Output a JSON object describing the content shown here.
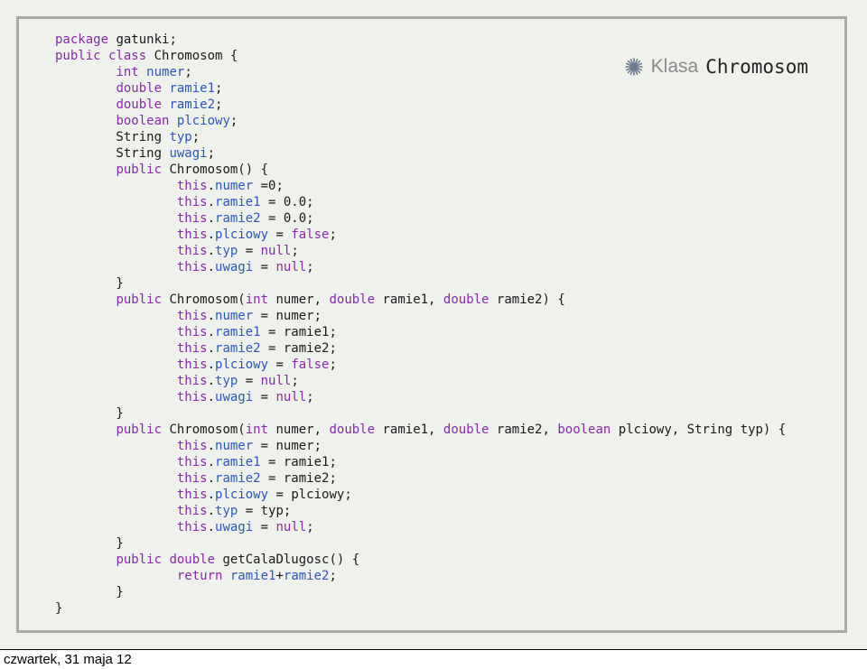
{
  "title": {
    "prefix": "Klasa",
    "class_name": "Chromosom",
    "bullet_icon": "asterisk-bullet-icon"
  },
  "footer": {
    "date": "czwartek, 31 maja 12"
  },
  "colors": {
    "keyword": "#862ba8",
    "identifier": "#2f55b8",
    "plain": "#1a1a1a",
    "background": "#eef1ec"
  },
  "code_lines": [
    [
      {
        "t": "kw",
        "v": "package"
      },
      {
        "t": "plain",
        "v": " gatunki;"
      }
    ],
    [
      {
        "t": "kw",
        "v": "public class"
      },
      {
        "t": "plain",
        "v": " Chromosom {"
      }
    ],
    [
      {
        "t": "plain",
        "v": "        "
      },
      {
        "t": "kw",
        "v": "int"
      },
      {
        "t": "plain",
        "v": " "
      },
      {
        "t": "id",
        "v": "numer"
      },
      {
        "t": "plain",
        "v": ";"
      }
    ],
    [
      {
        "t": "plain",
        "v": "        "
      },
      {
        "t": "kw",
        "v": "double"
      },
      {
        "t": "plain",
        "v": " "
      },
      {
        "t": "id",
        "v": "ramie1"
      },
      {
        "t": "plain",
        "v": ";"
      }
    ],
    [
      {
        "t": "plain",
        "v": "        "
      },
      {
        "t": "kw",
        "v": "double"
      },
      {
        "t": "plain",
        "v": " "
      },
      {
        "t": "id",
        "v": "ramie2"
      },
      {
        "t": "plain",
        "v": ";"
      }
    ],
    [
      {
        "t": "plain",
        "v": "        "
      },
      {
        "t": "kw",
        "v": "boolean"
      },
      {
        "t": "plain",
        "v": " "
      },
      {
        "t": "id",
        "v": "plciowy"
      },
      {
        "t": "plain",
        "v": ";"
      }
    ],
    [
      {
        "t": "plain",
        "v": "        String "
      },
      {
        "t": "id",
        "v": "typ"
      },
      {
        "t": "plain",
        "v": ";"
      }
    ],
    [
      {
        "t": "plain",
        "v": "        String "
      },
      {
        "t": "id",
        "v": "uwagi"
      },
      {
        "t": "plain",
        "v": ";"
      }
    ],
    [
      {
        "t": "plain",
        "v": "        "
      },
      {
        "t": "kw",
        "v": "public"
      },
      {
        "t": "plain",
        "v": " Chromosom() {"
      }
    ],
    [
      {
        "t": "plain",
        "v": "                "
      },
      {
        "t": "kw",
        "v": "this"
      },
      {
        "t": "plain",
        "v": "."
      },
      {
        "t": "id",
        "v": "numer"
      },
      {
        "t": "plain",
        "v": " =0;"
      }
    ],
    [
      {
        "t": "plain",
        "v": "                "
      },
      {
        "t": "kw",
        "v": "this"
      },
      {
        "t": "plain",
        "v": "."
      },
      {
        "t": "id",
        "v": "ramie1"
      },
      {
        "t": "plain",
        "v": " = 0.0;"
      }
    ],
    [
      {
        "t": "plain",
        "v": "                "
      },
      {
        "t": "kw",
        "v": "this"
      },
      {
        "t": "plain",
        "v": "."
      },
      {
        "t": "id",
        "v": "ramie2"
      },
      {
        "t": "plain",
        "v": " = 0.0;"
      }
    ],
    [
      {
        "t": "plain",
        "v": "                "
      },
      {
        "t": "kw",
        "v": "this"
      },
      {
        "t": "plain",
        "v": "."
      },
      {
        "t": "id",
        "v": "plciowy"
      },
      {
        "t": "plain",
        "v": " = "
      },
      {
        "t": "kw",
        "v": "false"
      },
      {
        "t": "plain",
        "v": ";"
      }
    ],
    [
      {
        "t": "plain",
        "v": "                "
      },
      {
        "t": "kw",
        "v": "this"
      },
      {
        "t": "plain",
        "v": "."
      },
      {
        "t": "id",
        "v": "typ"
      },
      {
        "t": "plain",
        "v": " = "
      },
      {
        "t": "kw",
        "v": "null"
      },
      {
        "t": "plain",
        "v": ";"
      }
    ],
    [
      {
        "t": "plain",
        "v": "                "
      },
      {
        "t": "kw",
        "v": "this"
      },
      {
        "t": "plain",
        "v": "."
      },
      {
        "t": "id",
        "v": "uwagi"
      },
      {
        "t": "plain",
        "v": " = "
      },
      {
        "t": "kw",
        "v": "null"
      },
      {
        "t": "plain",
        "v": ";"
      }
    ],
    [
      {
        "t": "plain",
        "v": "        }"
      }
    ],
    [
      {
        "t": "plain",
        "v": "        "
      },
      {
        "t": "kw",
        "v": "public"
      },
      {
        "t": "plain",
        "v": " Chromosom("
      },
      {
        "t": "kw",
        "v": "int"
      },
      {
        "t": "plain",
        "v": " numer, "
      },
      {
        "t": "kw",
        "v": "double"
      },
      {
        "t": "plain",
        "v": " ramie1, "
      },
      {
        "t": "kw",
        "v": "double"
      },
      {
        "t": "plain",
        "v": " ramie2) {"
      }
    ],
    [
      {
        "t": "plain",
        "v": "                "
      },
      {
        "t": "kw",
        "v": "this"
      },
      {
        "t": "plain",
        "v": "."
      },
      {
        "t": "id",
        "v": "numer"
      },
      {
        "t": "plain",
        "v": " = numer;"
      }
    ],
    [
      {
        "t": "plain",
        "v": "                "
      },
      {
        "t": "kw",
        "v": "this"
      },
      {
        "t": "plain",
        "v": "."
      },
      {
        "t": "id",
        "v": "ramie1"
      },
      {
        "t": "plain",
        "v": " = ramie1;"
      }
    ],
    [
      {
        "t": "plain",
        "v": "                "
      },
      {
        "t": "kw",
        "v": "this"
      },
      {
        "t": "plain",
        "v": "."
      },
      {
        "t": "id",
        "v": "ramie2"
      },
      {
        "t": "plain",
        "v": " = ramie2;"
      }
    ],
    [
      {
        "t": "plain",
        "v": "                "
      },
      {
        "t": "kw",
        "v": "this"
      },
      {
        "t": "plain",
        "v": "."
      },
      {
        "t": "id",
        "v": "plciowy"
      },
      {
        "t": "plain",
        "v": " = "
      },
      {
        "t": "kw",
        "v": "false"
      },
      {
        "t": "plain",
        "v": ";"
      }
    ],
    [
      {
        "t": "plain",
        "v": "                "
      },
      {
        "t": "kw",
        "v": "this"
      },
      {
        "t": "plain",
        "v": "."
      },
      {
        "t": "id",
        "v": "typ"
      },
      {
        "t": "plain",
        "v": " = "
      },
      {
        "t": "kw",
        "v": "null"
      },
      {
        "t": "plain",
        "v": ";"
      }
    ],
    [
      {
        "t": "plain",
        "v": "                "
      },
      {
        "t": "kw",
        "v": "this"
      },
      {
        "t": "plain",
        "v": "."
      },
      {
        "t": "id",
        "v": "uwagi"
      },
      {
        "t": "plain",
        "v": " = "
      },
      {
        "t": "kw",
        "v": "null"
      },
      {
        "t": "plain",
        "v": ";"
      }
    ],
    [
      {
        "t": "plain",
        "v": "        }"
      }
    ],
    [
      {
        "t": "plain",
        "v": "        "
      },
      {
        "t": "kw",
        "v": "public"
      },
      {
        "t": "plain",
        "v": " Chromosom("
      },
      {
        "t": "kw",
        "v": "int"
      },
      {
        "t": "plain",
        "v": " numer, "
      },
      {
        "t": "kw",
        "v": "double"
      },
      {
        "t": "plain",
        "v": " ramie1, "
      },
      {
        "t": "kw",
        "v": "double"
      },
      {
        "t": "plain",
        "v": " ramie2, "
      },
      {
        "t": "kw",
        "v": "boolean"
      },
      {
        "t": "plain",
        "v": " plciowy, String typ) {"
      }
    ],
    [
      {
        "t": "plain",
        "v": "                "
      },
      {
        "t": "kw",
        "v": "this"
      },
      {
        "t": "plain",
        "v": "."
      },
      {
        "t": "id",
        "v": "numer"
      },
      {
        "t": "plain",
        "v": " = numer;"
      }
    ],
    [
      {
        "t": "plain",
        "v": "                "
      },
      {
        "t": "kw",
        "v": "this"
      },
      {
        "t": "plain",
        "v": "."
      },
      {
        "t": "id",
        "v": "ramie1"
      },
      {
        "t": "plain",
        "v": " = ramie1;"
      }
    ],
    [
      {
        "t": "plain",
        "v": "                "
      },
      {
        "t": "kw",
        "v": "this"
      },
      {
        "t": "plain",
        "v": "."
      },
      {
        "t": "id",
        "v": "ramie2"
      },
      {
        "t": "plain",
        "v": " = ramie2;"
      }
    ],
    [
      {
        "t": "plain",
        "v": "                "
      },
      {
        "t": "kw",
        "v": "this"
      },
      {
        "t": "plain",
        "v": "."
      },
      {
        "t": "id",
        "v": "plciowy"
      },
      {
        "t": "plain",
        "v": " = plciowy;"
      }
    ],
    [
      {
        "t": "plain",
        "v": "                "
      },
      {
        "t": "kw",
        "v": "this"
      },
      {
        "t": "plain",
        "v": "."
      },
      {
        "t": "id",
        "v": "typ"
      },
      {
        "t": "plain",
        "v": " = typ;"
      }
    ],
    [
      {
        "t": "plain",
        "v": "                "
      },
      {
        "t": "kw",
        "v": "this"
      },
      {
        "t": "plain",
        "v": "."
      },
      {
        "t": "id",
        "v": "uwagi"
      },
      {
        "t": "plain",
        "v": " = "
      },
      {
        "t": "kw",
        "v": "null"
      },
      {
        "t": "plain",
        "v": ";"
      }
    ],
    [
      {
        "t": "plain",
        "v": "        }"
      }
    ],
    [
      {
        "t": "plain",
        "v": "        "
      },
      {
        "t": "kw",
        "v": "public double"
      },
      {
        "t": "plain",
        "v": " getCalaDlugosc() {"
      }
    ],
    [
      {
        "t": "plain",
        "v": "                "
      },
      {
        "t": "kw",
        "v": "return"
      },
      {
        "t": "plain",
        "v": " "
      },
      {
        "t": "id",
        "v": "ramie1"
      },
      {
        "t": "plain",
        "v": "+"
      },
      {
        "t": "id",
        "v": "ramie2"
      },
      {
        "t": "plain",
        "v": ";"
      }
    ],
    [
      {
        "t": "plain",
        "v": "        }"
      }
    ],
    [
      {
        "t": "plain",
        "v": "}"
      }
    ]
  ]
}
